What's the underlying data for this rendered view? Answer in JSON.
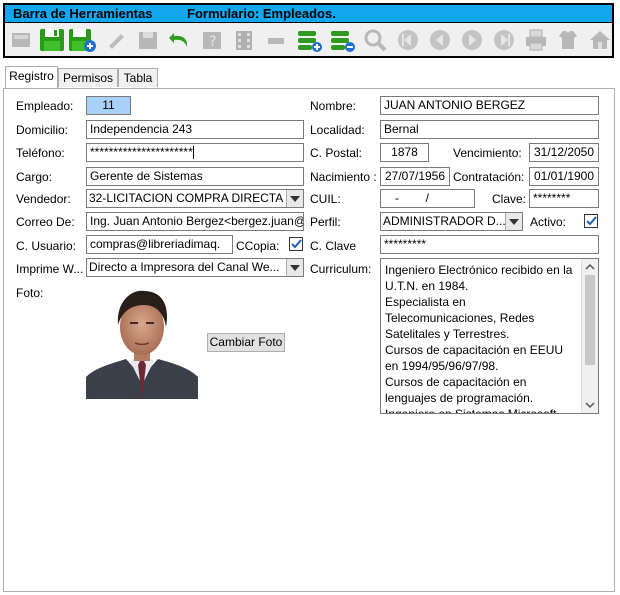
{
  "toolbar": {
    "title": "Barra de Herramientas",
    "form_title": "Formulario: Empleados."
  },
  "tabs": [
    "Registro",
    "Permisos",
    "Tabla"
  ],
  "form": {
    "empleado": {
      "label": "Empleado:",
      "value": "11"
    },
    "nombre": {
      "label": "Nombre:",
      "value": "JUAN ANTONIO BERGEZ"
    },
    "domicilio": {
      "label": "Domicilio:",
      "value": "Independencia 243"
    },
    "localidad": {
      "label": "Localidad:",
      "value": "Bernal"
    },
    "telefono": {
      "label": "Teléfono:",
      "value": "**********************"
    },
    "cpostal": {
      "label": "C. Postal:",
      "value": "1878"
    },
    "vencimiento": {
      "label": "Vencimiento:",
      "value": "31/12/2050"
    },
    "cargo": {
      "label": "Cargo:",
      "value": "Gerente de Sistemas"
    },
    "nacimiento": {
      "label": "Nacimiento :",
      "value": "27/07/1956"
    },
    "contratacion": {
      "label": "Contratación:",
      "value": "01/01/1900"
    },
    "vendedor": {
      "label": "Vendedor:",
      "value": "32-LICITACION COMPRA DIRECTA"
    },
    "cuil": {
      "label": "CUIL:",
      "value": "-        /"
    },
    "clave": {
      "label": "Clave:",
      "value": "********"
    },
    "correo": {
      "label": "Correo De:",
      "value": "Ing. Juan Antonio Bergez<bergez.juan@"
    },
    "perfil": {
      "label": "Perfil:",
      "value": "ADMINISTRADOR D..."
    },
    "activo": {
      "label": "Activo:",
      "checked": true
    },
    "cusuario": {
      "label": "C. Usuario:",
      "value": "compras@libreriadimaq."
    },
    "ccopia": {
      "label": "CCopia:",
      "checked": true
    },
    "cclave": {
      "label": "C. Clave",
      "value": "*********"
    },
    "imprime": {
      "label": "Imprime W...",
      "value": "Directo a Impresora del Canal We..."
    },
    "curriculum": {
      "label": "Curriculum:",
      "lines": [
        "Ingeniero Electrónico recibido en la",
        "U.T.N. en 1984.",
        "Especialista en",
        "Telecomunicaciones, Redes",
        "Satelitales y Terrestres.",
        "Cursos de capacitación en EEUU",
        "en 1994/95/96/97/98.",
        "Cursos de capacitación en",
        "lenguajes de programación.",
        "Ingeniero en Sistemas Microsoft"
      ]
    },
    "foto": {
      "label": "Foto:"
    },
    "cambiar_foto": "Cambiar Foto"
  }
}
